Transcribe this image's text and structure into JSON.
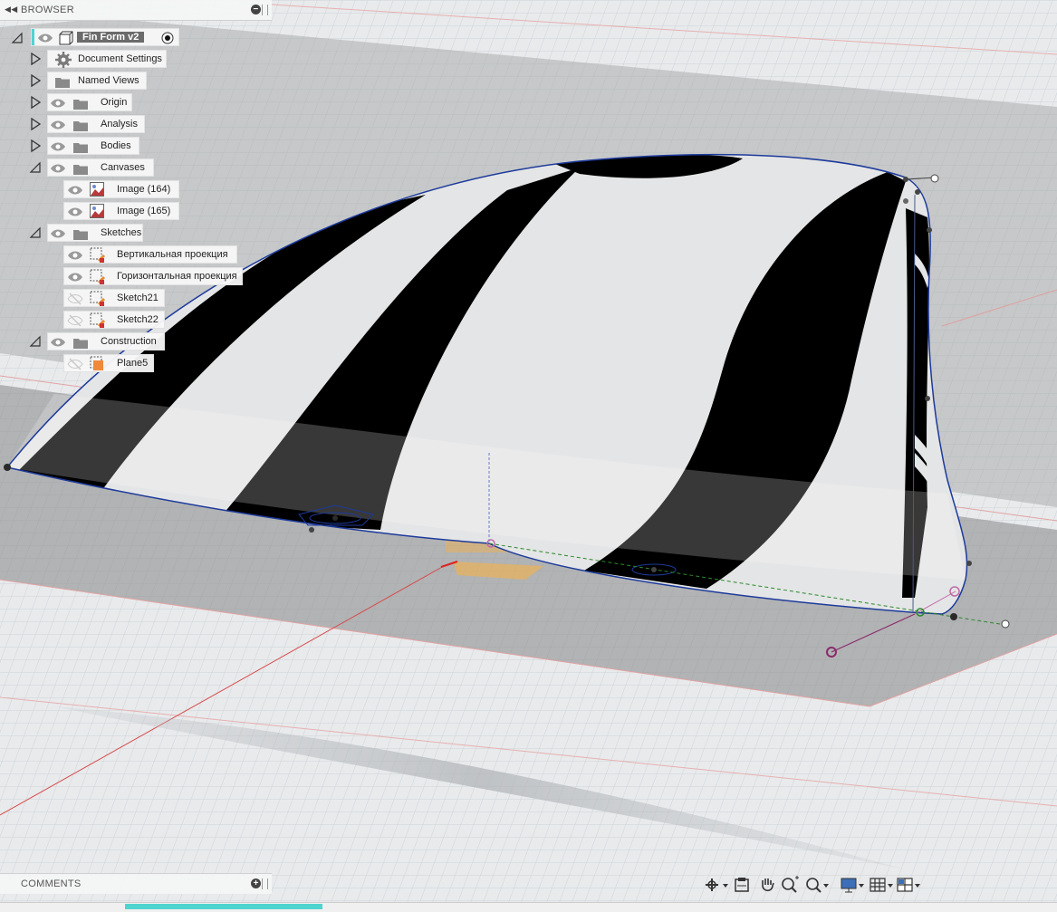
{
  "browser": {
    "title": "BROWSER",
    "root": {
      "label": "Fin  Form v2"
    },
    "items": [
      {
        "label": "Document Settings",
        "icon": "gear-icon"
      },
      {
        "label": "Named Views",
        "icon": "folder-icon"
      },
      {
        "label": "Origin",
        "icon": "folder-icon"
      },
      {
        "label": "Analysis",
        "icon": "folder-icon"
      },
      {
        "label": "Bodies",
        "icon": "folder-icon"
      },
      {
        "label": "Canvases",
        "icon": "folder-icon"
      },
      {
        "label": "Image (164)",
        "icon": "image-icon"
      },
      {
        "label": "Image (165)",
        "icon": "image-icon"
      },
      {
        "label": "Sketches",
        "icon": "folder-icon"
      },
      {
        "label": "Вертикальная проекция",
        "icon": "sketch-icon"
      },
      {
        "label": "Горизонтальная проекция",
        "icon": "sketch-icon"
      },
      {
        "label": "Sketch21",
        "icon": "sketch-icon"
      },
      {
        "label": "Sketch22",
        "icon": "sketch-icon"
      },
      {
        "label": "Construction",
        "icon": "folder-icon"
      },
      {
        "label": "Plane5",
        "icon": "plane-icon"
      }
    ]
  },
  "comments": {
    "title": "COMMENTS"
  },
  "toolbar": {
    "tools": [
      "orbit-icon",
      "look-at-icon",
      "pan-icon",
      "zoom-window-icon",
      "zoom-icon",
      "display-settings-icon",
      "grid-icon",
      "viewports-icon"
    ]
  },
  "colors": {
    "accent": "#4fd4cf",
    "edge": "#1d3a9b",
    "construction": "#f5b14a"
  }
}
